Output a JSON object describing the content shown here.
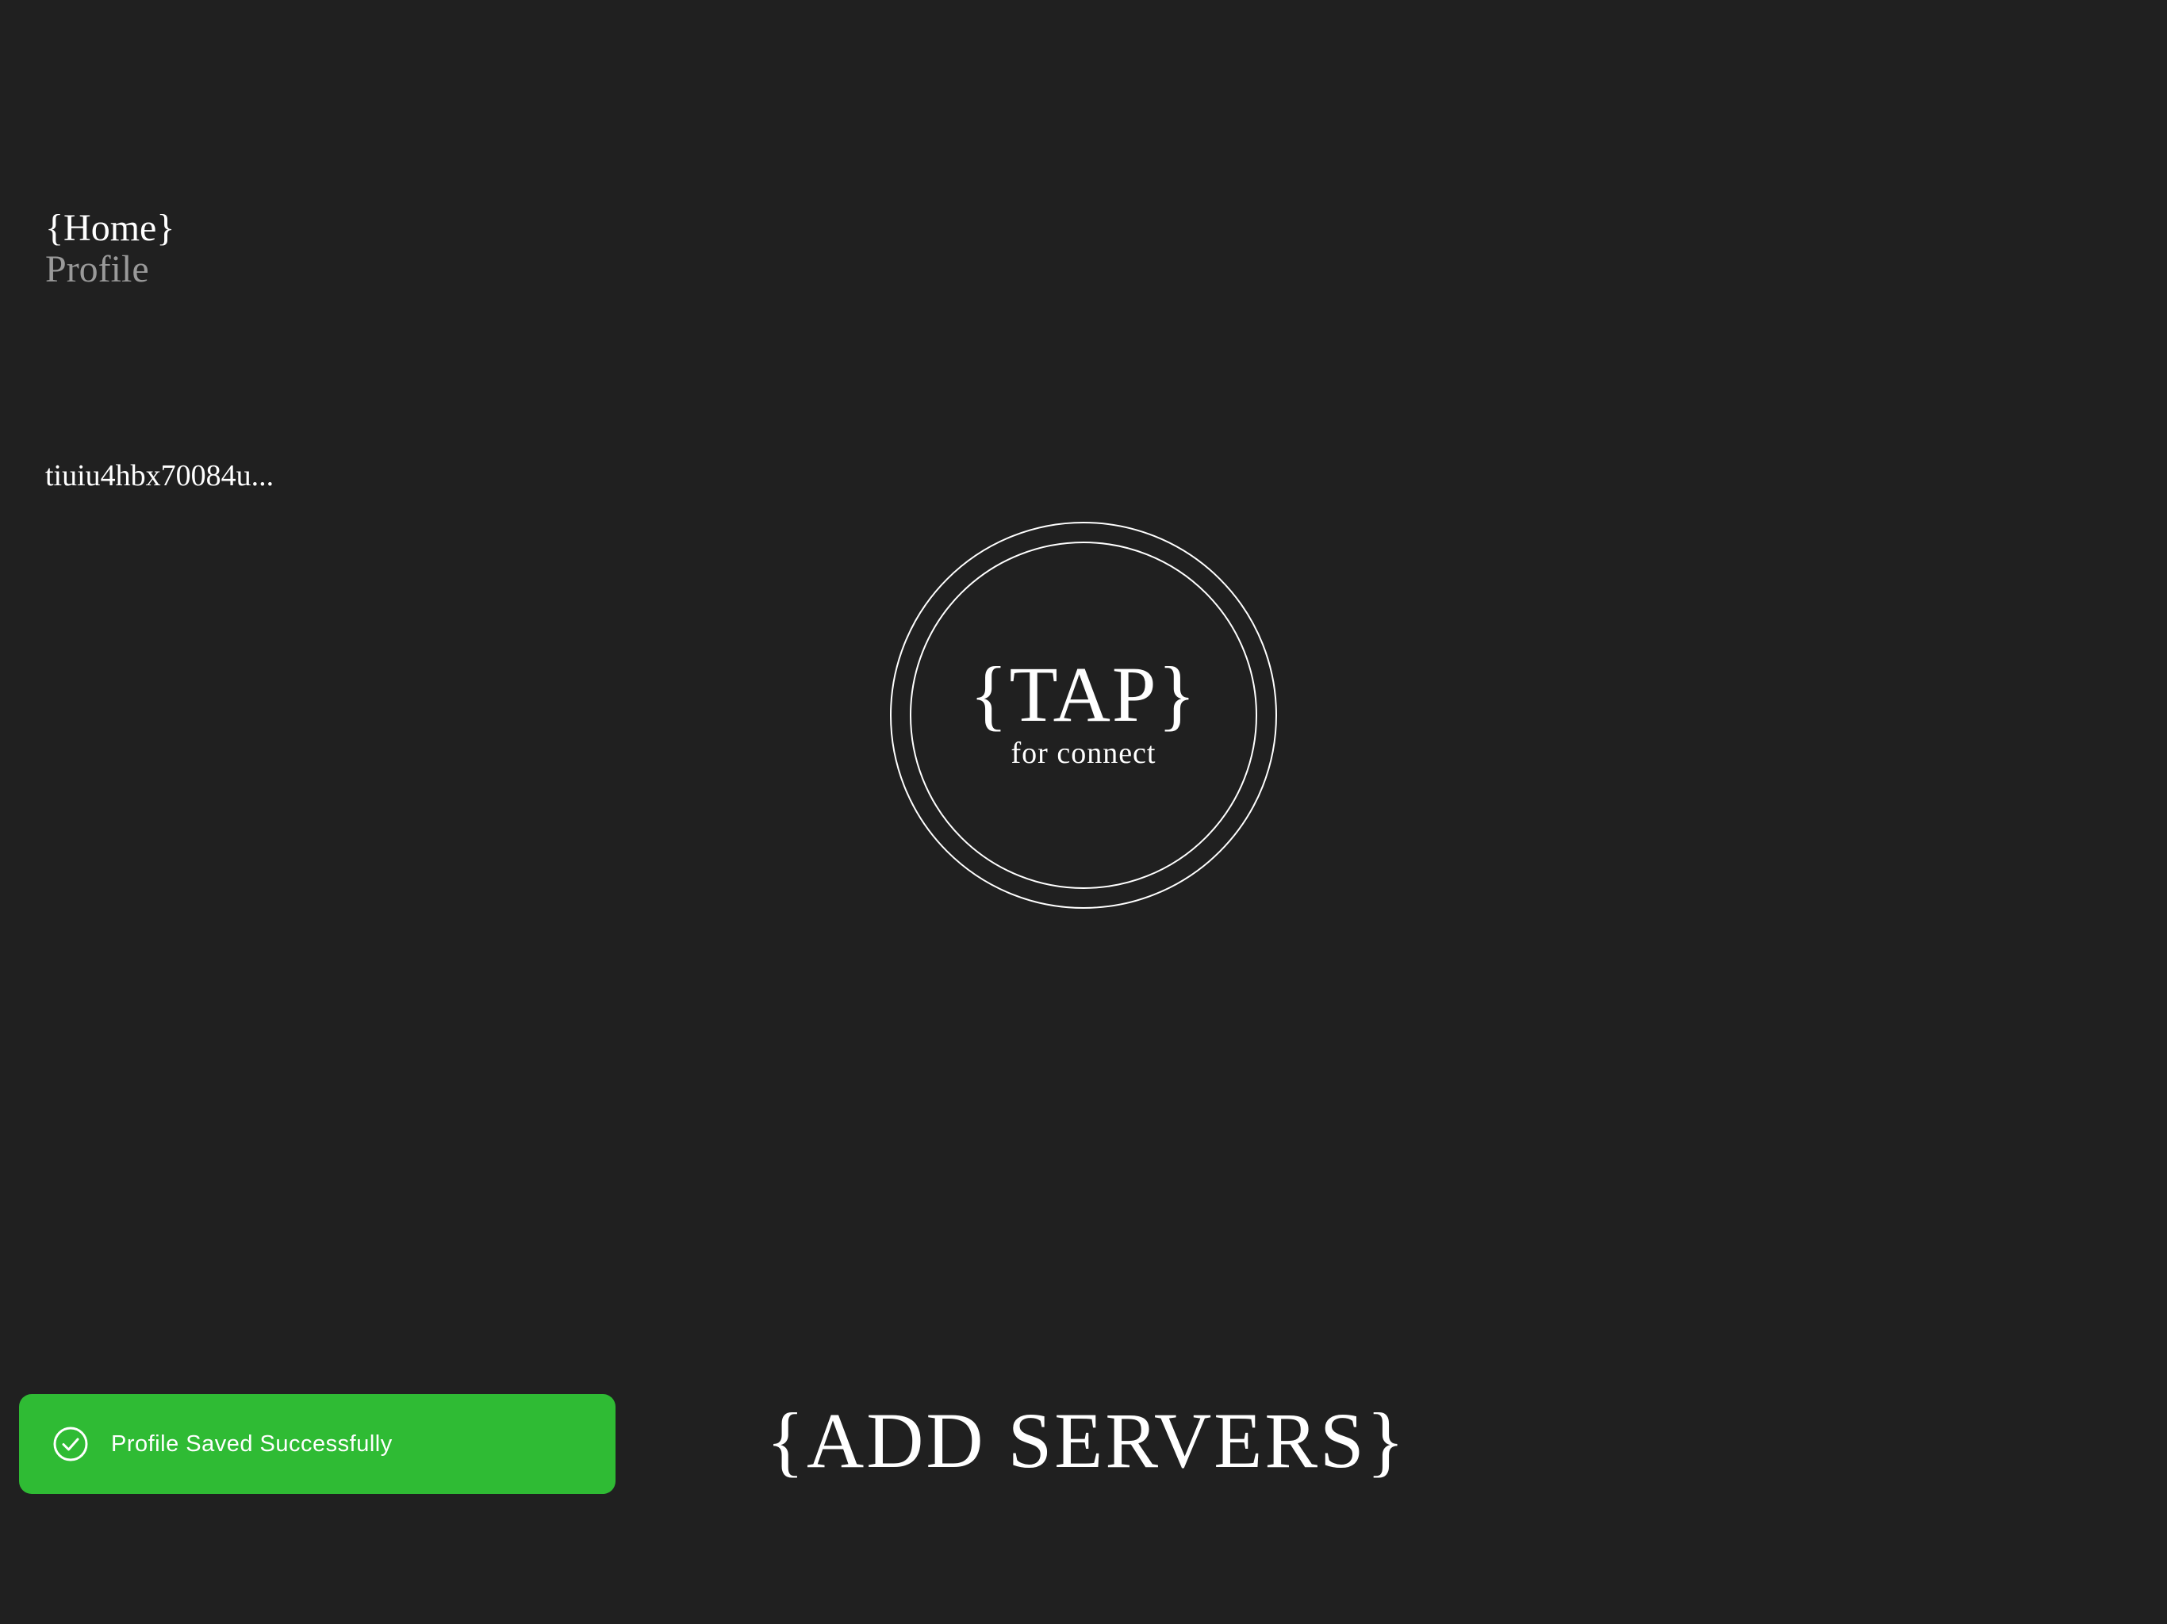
{
  "nav": {
    "items": [
      {
        "label": "{Home}",
        "active": true
      },
      {
        "label": "Profile",
        "active": false
      }
    ]
  },
  "user": {
    "id_text": "tiuiu4hbx70084u..."
  },
  "connect": {
    "label": "{TAP}",
    "sublabel": "for connect",
    "icon": "double-ring"
  },
  "add_servers": {
    "label": "{ADD SERVERS}"
  },
  "toast": {
    "message": "Profile Saved Successfully",
    "icon": "check-circle-icon",
    "color": "#2fbb34"
  },
  "colors": {
    "background": "#202020",
    "text": "#ffffff",
    "inactive_text": "#9a9a9a"
  }
}
